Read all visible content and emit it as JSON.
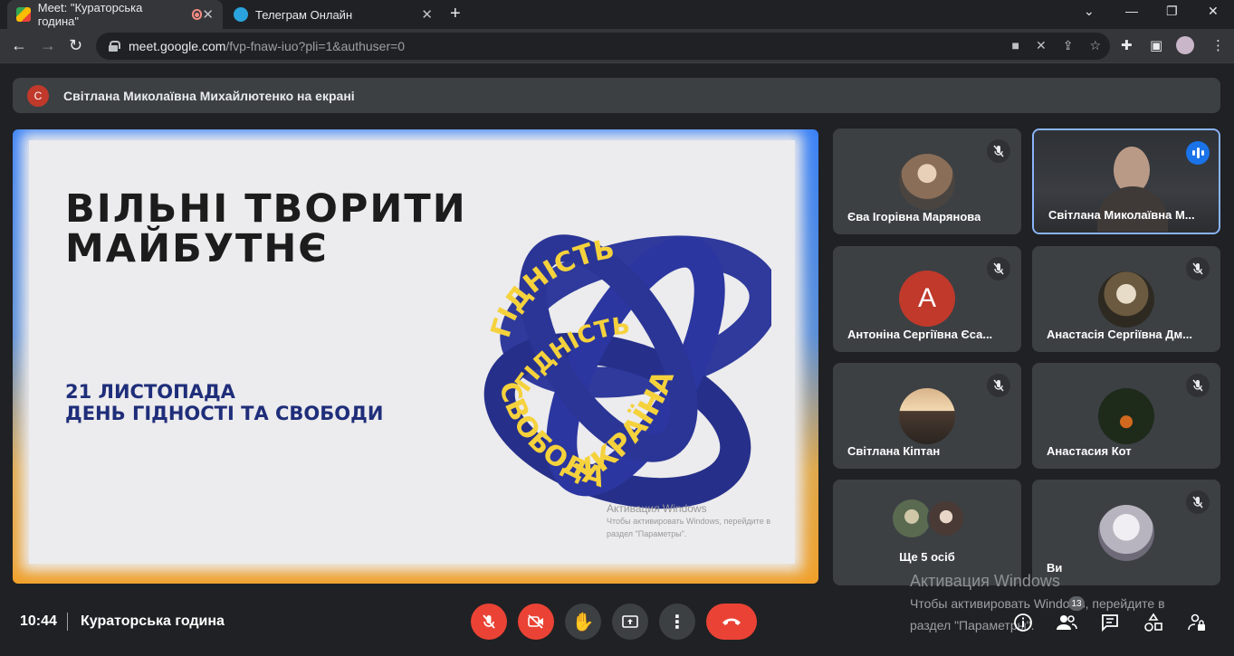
{
  "browser": {
    "tabs": [
      {
        "title": "Meet: \"Кураторська година\"",
        "favicon": "google-meet-icon"
      },
      {
        "title": "Телеграм Онлайн",
        "favicon": "telegram-icon"
      }
    ],
    "url_host": "meet.google.com",
    "url_path": "/fvp-fnaw-iuo?pli=1&authuser=0"
  },
  "banner": {
    "avatar_letter": "С",
    "text": "Світлана Миколаївна Михайлютенко на екрані"
  },
  "slide": {
    "title_line1": "ВІЛЬНІ ТВОРИТИ",
    "title_line2": "МАЙБУТНЄ",
    "sub_line1": "21 ЛИСТОПАДА",
    "sub_line2": "ДЕНЬ ГІДНОСТІ ТА СВОБОДИ",
    "ribbon_words": [
      "ГІДНІСТЬ",
      "ГІДНІСТЬ",
      "УКРАЇНА",
      "СВОБОДА"
    ],
    "watermark_title": "Активация Windows",
    "watermark_line1": "Чтобы активировать Windows, перейдите в",
    "watermark_line2": "раздел \"Параметры\"."
  },
  "participants": [
    {
      "name": "Єва Ігорівна Марянова",
      "muted": true
    },
    {
      "name": "Світлана Миколаївна М...",
      "speaking": true
    },
    {
      "name": "Антоніна Сергіївна Єса...",
      "muted": true,
      "avatar_letter": "А"
    },
    {
      "name": "Анастасія Сергіївна Дм...",
      "muted": true
    },
    {
      "name": "Світлана Кіптан",
      "muted": true
    },
    {
      "name": "Анастасия Кот",
      "muted": true
    },
    {
      "name": "Ще 5 осіб"
    },
    {
      "name": "Ви",
      "muted": true
    }
  ],
  "bottom": {
    "time": "10:44",
    "meeting_title": "Кураторська година",
    "people_count": "13"
  },
  "windows_activation": {
    "title": "Активация Windows",
    "line1": "Чтобы активировать Windows, перейдите в",
    "line2": "раздел \"Параметры\"."
  },
  "colors": {
    "meet_red": "#ea4335",
    "accent_blue": "#8ab4f8",
    "slide_navy": "#1f2e7a",
    "ribbon_yellow": "#f5d23c"
  }
}
